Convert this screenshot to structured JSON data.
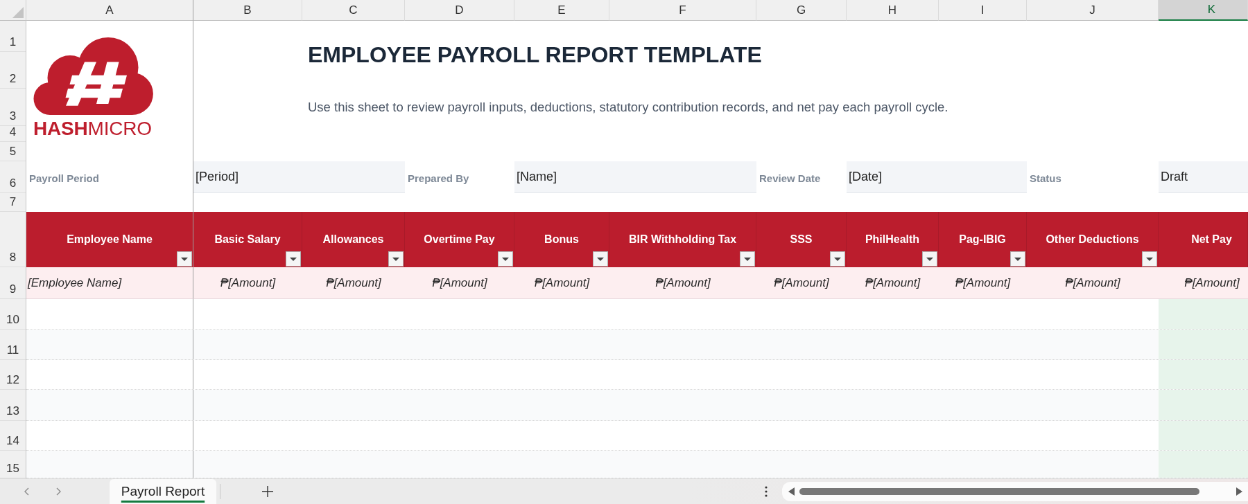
{
  "column_headers": [
    {
      "label": "A",
      "selected": false
    },
    {
      "label": "B",
      "selected": false
    },
    {
      "label": "C",
      "selected": false
    },
    {
      "label": "D",
      "selected": false
    },
    {
      "label": "E",
      "selected": false
    },
    {
      "label": "F",
      "selected": false
    },
    {
      "label": "G",
      "selected": false
    },
    {
      "label": "H",
      "selected": false
    },
    {
      "label": "I",
      "selected": false
    },
    {
      "label": "J",
      "selected": false
    },
    {
      "label": "K",
      "selected": true
    }
  ],
  "row_numbers": [
    "1",
    "2",
    "3",
    "4",
    "5",
    "6",
    "7",
    "8",
    "9",
    "10",
    "11",
    "12",
    "13",
    "14",
    "15"
  ],
  "logo": {
    "text": "**HASH**MICRO"
  },
  "title": "EMPLOYEE PAYROLL REPORT TEMPLATE",
  "subtitle": "Use this sheet to review payroll inputs, deductions, statutory contribution records, and net pay each payroll cycle.",
  "meta": [
    {
      "label": "Payroll Period",
      "value": "[Period]"
    },
    {
      "label": "Prepared By",
      "value": "[Name]"
    },
    {
      "label": "Review Date",
      "value": "[Date]"
    },
    {
      "label": "Status",
      "value": "Draft"
    }
  ],
  "table": {
    "columns": [
      {
        "label": "Employee Name",
        "filter": true
      },
      {
        "label": "Basic Salary",
        "filter": true
      },
      {
        "label": "Allowances",
        "filter": true
      },
      {
        "label": "Overtime Pay",
        "filter": true
      },
      {
        "label": "Bonus",
        "filter": true
      },
      {
        "label": "BIR Withholding Tax",
        "filter": true
      },
      {
        "label": "SSS",
        "filter": true
      },
      {
        "label": "PhilHealth",
        "filter": true
      },
      {
        "label": "Pag-IBIG",
        "filter": true
      },
      {
        "label": "Other Deductions",
        "filter": true
      },
      {
        "label": "Net Pay",
        "filter": false
      }
    ],
    "rows": [
      [
        "[Employee Name]",
        "₱[Amount]",
        "₱[Amount]",
        "₱[Amount]",
        "₱[Amount]",
        "₱[Amount]",
        "₱[Amount]",
        "₱[Amount]",
        "₱[Amount]",
        "₱[Amount]",
        "₱[Amount]"
      ]
    ]
  },
  "sheet_tabs": [
    {
      "label": "Payroll Report",
      "selected": true
    }
  ]
}
